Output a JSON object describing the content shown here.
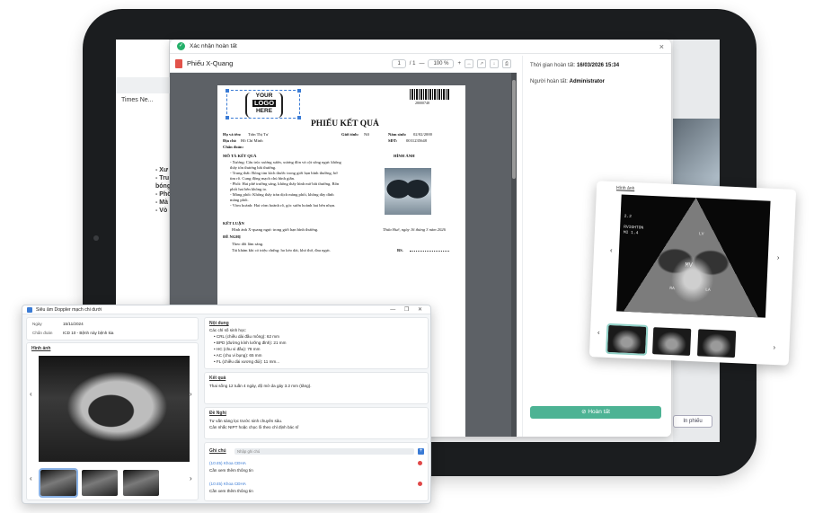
{
  "dialog": {
    "title": "Xác nhận hoàn tất",
    "doc_title": "Phiếu X-Quang",
    "page_current": "1",
    "page_total": "/ 1",
    "zoom": "100",
    "zoom_unit": "%",
    "zoom_minus": "—",
    "zoom_plus": "+",
    "close": "×"
  },
  "report": {
    "logo_line1": "YOUR",
    "logo_line2": "LOGO",
    "logo_line3": "HERE",
    "barcode_number": "28000748",
    "title": "PHIẾU KẾT QUẢ",
    "name_label": "Họ và tên:",
    "name_value": "Trần Thị Tư",
    "gender_label": "Giới tính:",
    "gender_value": "Nữ",
    "birth_label": "Năm sinh:",
    "birth_value": "02/02/2000",
    "address_label": "Địa chỉ:",
    "address_value": "Hồ Chí Minh",
    "phone_label": "SĐT:",
    "phone_value": "0031235648",
    "diagnosis_label": "Chẩn đoán:",
    "describe_header": "MÔ TẢ KẾT QUẢ",
    "image_header": "HÌNH ẢNH",
    "desc_lines": [
      "- Xương: Cấu trúc xương sườn, xương đòn và cột sống ngực không",
      "thấy tổn thương bất thường.",
      "- Trung thất: Bóng tim kích thước trong giới hạn bình thường, bờ",
      "tim rõ. Cung động mạch chủ bình giãn.",
      "- Phổi: Hai phế trường sáng, không thấy hình mờ bất thường. Rốn",
      "phổi hai bên không to.",
      "- Màng phổi: Không thấy tràn dịch màng phổi, không dày dính",
      "màng phổi.",
      "- Vòm hoành: Hai vòm hoành rõ, góc sườn hoành hai bên nhọn."
    ],
    "conclusion_header": "KẾT LUẬN",
    "conclusion_text": "Hình ảnh X-quang ngực trong giới hạn bình thường.",
    "date_text": "Thừa Huế, ngày 16 tháng 3 năm 2026",
    "suggest_header": "ĐỀ NGHỊ",
    "suggest_1": "Theo dõi lâm sàng.",
    "suggest_2": "Tái khám khi có triệu chứng: ho kéo dài, khó thở, đau ngực.",
    "doctor_label": "BS."
  },
  "right_panel": {
    "time_label": "Thời gian hoàn tất:",
    "time_value": "16/03/2026 15:34",
    "person_label": "Người hoàn tất:",
    "person_value": "Administrator",
    "done_button": "Hoàn tất"
  },
  "background": {
    "font_select": "Times Ne...",
    "phieu_button": "In phiếu",
    "side_lines": [
      "- Xư",
      "- Tru",
      "bóng",
      "- Phổ",
      "- Mà",
      "- Vò"
    ]
  },
  "doppler": {
    "title": "Siêu âm Doppler mạch chi dưới",
    "date_label": "Ngày",
    "date_value": "15/11/2024",
    "diag_label": "Chẩn đoán",
    "diag_value": "ICD 10 - Bệnh này bệnh kia",
    "image_label": "Hình ảnh",
    "content_label": "Nội dung",
    "content_intro": "Các chỉ số sinh học:",
    "metrics": [
      "CRL (chiều dài đầu mông): 62 mm",
      "BPD (đường kính lưỡng đỉnh): 21 mm",
      "HC (chu vi đầu): 78 mm",
      "AC (chu vi bụng): 65 mm",
      "FL (chiều dài xương đùi): 11 mm..."
    ],
    "result_label": "Kết quả",
    "result_text": "Thai sống 12 tuần 4 ngày, độ mờ da gáy 3.2 mm (tăng).",
    "suggest_label": "Đề Nghị",
    "suggest_1": "Tư vấn sàng lọc trước sinh chuyên sâu.",
    "suggest_2": "Cân nhắc NIPT hoặc chọc ối theo chỉ định bác sĩ",
    "notes_label": "Ghi chú",
    "notes_placeholder": "Nhập ghi chú",
    "notes": [
      {
        "author": "(10:45) Khoa CĐHA",
        "text": "Cần xem thêm thông tin"
      },
      {
        "author": "(10:45) Khoa CĐHA",
        "text": "Cần xem thêm thông tin"
      }
    ],
    "win_controls": "— ❐ ✕"
  },
  "echo": {
    "label": "Hình ảnh",
    "overlay_1": "2.2",
    "overlay_2": "MI 1.4",
    "overlay_3": "RVIGHTON",
    "overlay_4": "LV",
    "overlay_5": "MV",
    "overlay_6": "LA",
    "overlay_7": "RA"
  },
  "icons": {
    "arrow_left": "‹",
    "arrow_right": "›"
  }
}
